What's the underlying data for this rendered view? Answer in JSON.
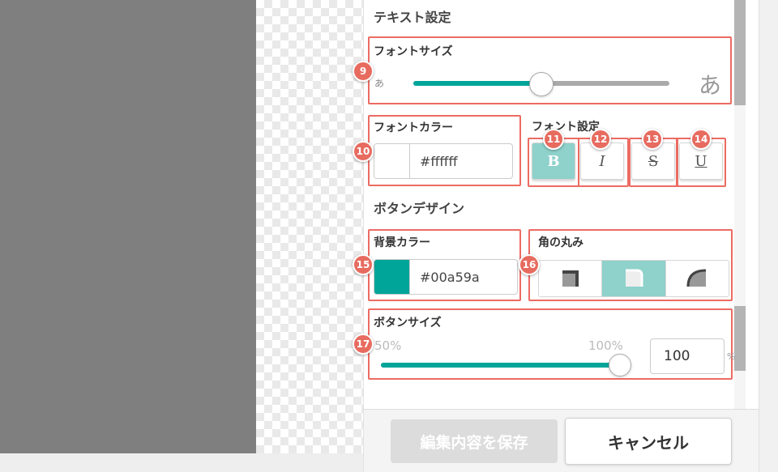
{
  "text_settings": {
    "title": "テキスト設定",
    "font_size": {
      "label": "フォントサイズ",
      "min_glyph": "あ",
      "max_glyph": "あ",
      "value_fraction": 0.5
    },
    "font_color": {
      "label": "フォントカラー",
      "value": "#ffffff"
    },
    "font_style": {
      "label": "フォント設定",
      "bold": "B",
      "italic": "I",
      "strike": "S",
      "underline": "U"
    }
  },
  "button_design": {
    "title": "ボタンデザイン",
    "bg_color": {
      "label": "背景カラー",
      "value": "#00a59a"
    },
    "corner_radius": {
      "label": "角の丸み",
      "options": [
        "square",
        "rounded",
        "round"
      ],
      "selected": "rounded"
    },
    "button_size": {
      "label": "ボタンサイズ",
      "min_label": "50%",
      "max_label": "100%",
      "value": "100",
      "unit": "%",
      "value_fraction": 1.0
    }
  },
  "badges": [
    "9",
    "10",
    "11",
    "12",
    "13",
    "14",
    "15",
    "16",
    "17"
  ],
  "footer": {
    "save_label": "編集内容を保存",
    "cancel_label": "キャンセル"
  },
  "colors": {
    "accent": "#00a59a",
    "accent_light": "#8fd1cb",
    "highlight": "#ec6b62",
    "badge": "#e76b5f"
  }
}
